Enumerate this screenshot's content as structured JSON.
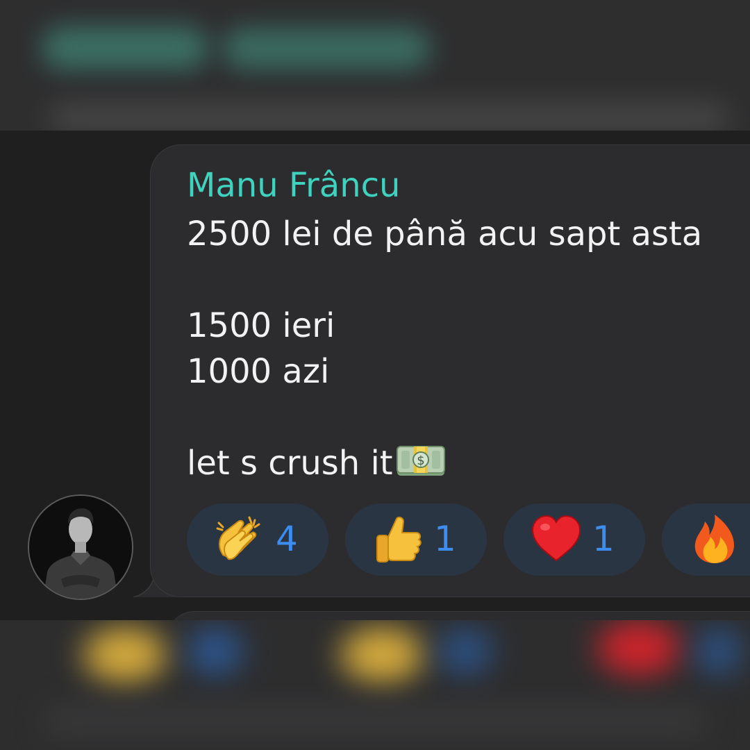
{
  "message": {
    "sender": "Manu Frâncu",
    "lines": [
      "2500 lei de până acu sapt asta",
      "",
      "1500 ieri",
      "1000 azi",
      "",
      "let s crush it"
    ],
    "trailing_emoji": "money-bag-icon"
  },
  "reactions": [
    {
      "emoji": "clapping-hands-icon",
      "count": "4"
    },
    {
      "emoji": "thumbs-up-icon",
      "count": "1"
    },
    {
      "emoji": "red-heart-icon",
      "count": "1"
    },
    {
      "emoji": "fire-icon",
      "count": ""
    }
  ],
  "colors": {
    "sender_name": "#3fd2bf",
    "reaction_count": "#3d8cf0",
    "bubble_bg": "#2c2c2e",
    "chat_bg": "#1f1f20",
    "reaction_bg": "#2a3543"
  }
}
